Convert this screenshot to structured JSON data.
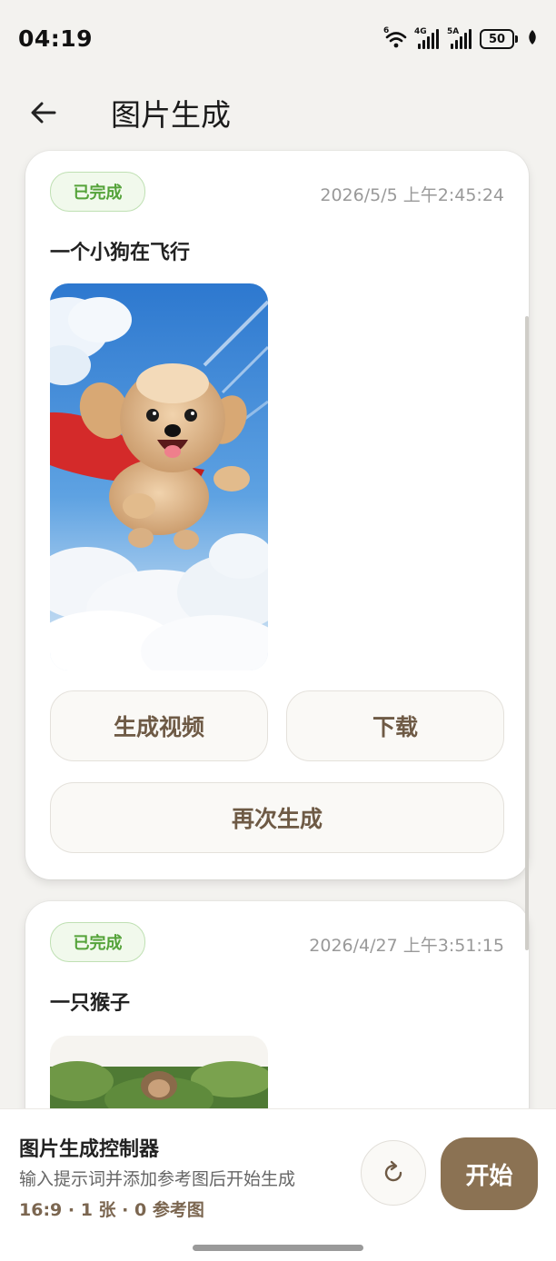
{
  "status_bar": {
    "time": "04:19",
    "wifi_label": "6",
    "signal1_label": "4G",
    "signal2_label": "5A",
    "battery": "50"
  },
  "header": {
    "title": "图片生成",
    "back_icon": "arrow-left-icon"
  },
  "cards": [
    {
      "status": "已完成",
      "timestamp": "2026/5/5 上午2:45:24",
      "prompt": "一个小狗在飞行",
      "buttons": {
        "generate_video": "生成视频",
        "download": "下载",
        "regenerate": "再次生成"
      }
    },
    {
      "status": "已完成",
      "timestamp": "2026/4/27 上午3:51:15",
      "prompt": "一只猴子"
    }
  ],
  "controller": {
    "title": "图片生成控制器",
    "subtitle": "输入提示词并添加参考图后开始生成",
    "meta": "16:9 · 1 张 · 0 参考图",
    "start_label": "开始",
    "refresh_icon": "refresh-icon"
  },
  "colors": {
    "accent": "#8b7253",
    "status_green": "#55a33a",
    "button_text": "#6e5a45",
    "background": "#f3f2ef"
  }
}
